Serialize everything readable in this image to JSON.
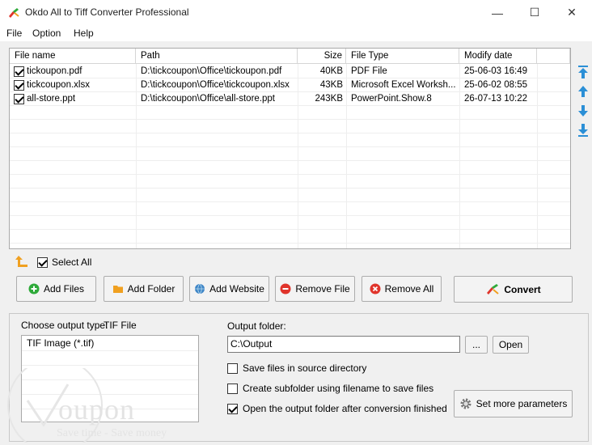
{
  "window": {
    "title": "Okdo All to Tiff Converter Professional",
    "minimize": "—",
    "maximize": "☐",
    "close": "✕"
  },
  "menu": [
    "File",
    "Option",
    "Help"
  ],
  "file_list": {
    "columns": [
      "File name",
      "Path",
      "Size",
      "File Type",
      "Modify date"
    ],
    "rows": [
      {
        "checked": true,
        "name": "tickoupon.pdf",
        "path": "D:\\tickcoupon\\Office\\tickoupon.pdf",
        "size": "40KB",
        "type": "PDF File",
        "date": "25-06-03 16:49"
      },
      {
        "checked": true,
        "name": "tickcoupon.xlsx",
        "path": "D:\\tickcoupon\\Office\\tickcoupon.xlsx",
        "size": "43KB",
        "type": "Microsoft Excel Worksh...",
        "date": "25-06-02 08:55"
      },
      {
        "checked": true,
        "name": "all-store.ppt",
        "path": "D:\\tickcoupon\\Office\\all-store.ppt",
        "size": "243KB",
        "type": "PowerPoint.Show.8",
        "date": "26-07-13 10:22"
      }
    ]
  },
  "select_all": {
    "label": "Select All",
    "checked": true
  },
  "buttons": {
    "add_files": "Add Files",
    "add_folder": "Add Folder",
    "add_website": "Add Website",
    "remove_file": "Remove File",
    "remove_all": "Remove All",
    "convert": "Convert",
    "browse": "...",
    "open": "Open",
    "set_params": "Set more parameters"
  },
  "output": {
    "type_label": "Choose output type:",
    "type_value": "TIF File",
    "formats": [
      "TIF Image (*.tif)"
    ],
    "folder_label": "Output folder:",
    "folder_value": "C:\\Output",
    "options": [
      {
        "label": "Save files in source directory",
        "checked": false
      },
      {
        "label": "Create subfolder using filename to save files",
        "checked": false
      },
      {
        "label": "Open the output folder after conversion finished",
        "checked": true
      }
    ]
  },
  "watermark": {
    "text": "oupon",
    "tagline": "Save time - Save money"
  },
  "colors": {
    "accent_blue": "#2b8fd6",
    "green": "#2eaa3a",
    "red": "#e0342b",
    "orange": "#f0a020"
  }
}
